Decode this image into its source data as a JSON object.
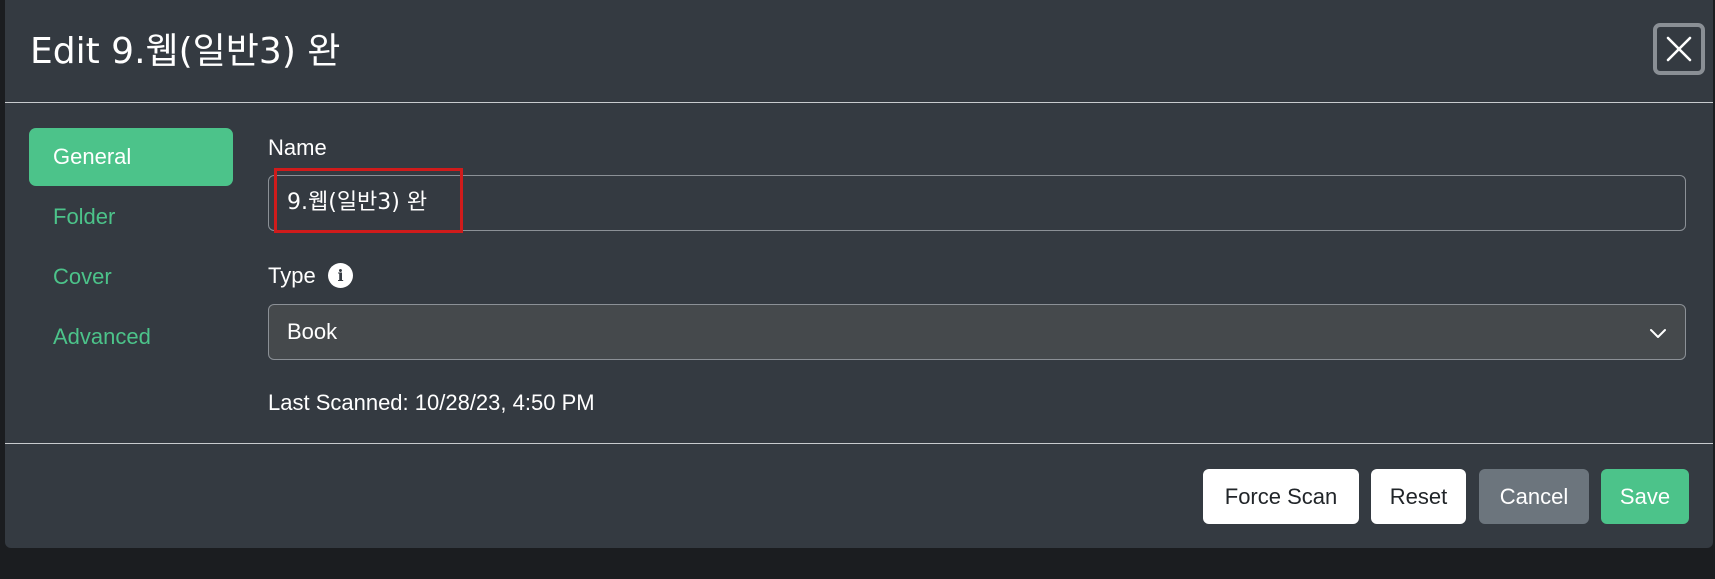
{
  "dialog": {
    "title": "Edit 9.웹(일반3) 완",
    "close_label": "×"
  },
  "nav": {
    "items": [
      {
        "label": "General",
        "active": true
      },
      {
        "label": "Folder",
        "active": false
      },
      {
        "label": "Cover",
        "active": false
      },
      {
        "label": "Advanced",
        "active": false
      }
    ]
  },
  "form": {
    "name_label": "Name",
    "name_value": "9.웹(일반3) 완",
    "type_label": "Type",
    "type_selected": "Book",
    "last_scanned": "Last Scanned: 10/28/23, 4:50 PM"
  },
  "footer": {
    "force_scan_label": "Force Scan",
    "reset_label": "Reset",
    "cancel_label": "Cancel",
    "save_label": "Save"
  },
  "icons": {
    "close": "close-icon",
    "info": "info-icon",
    "chevron": "chevron-down-icon"
  },
  "colors": {
    "accent": "#4cc38a",
    "modal_bg": "#343a41",
    "highlight": "#d01b1b"
  }
}
